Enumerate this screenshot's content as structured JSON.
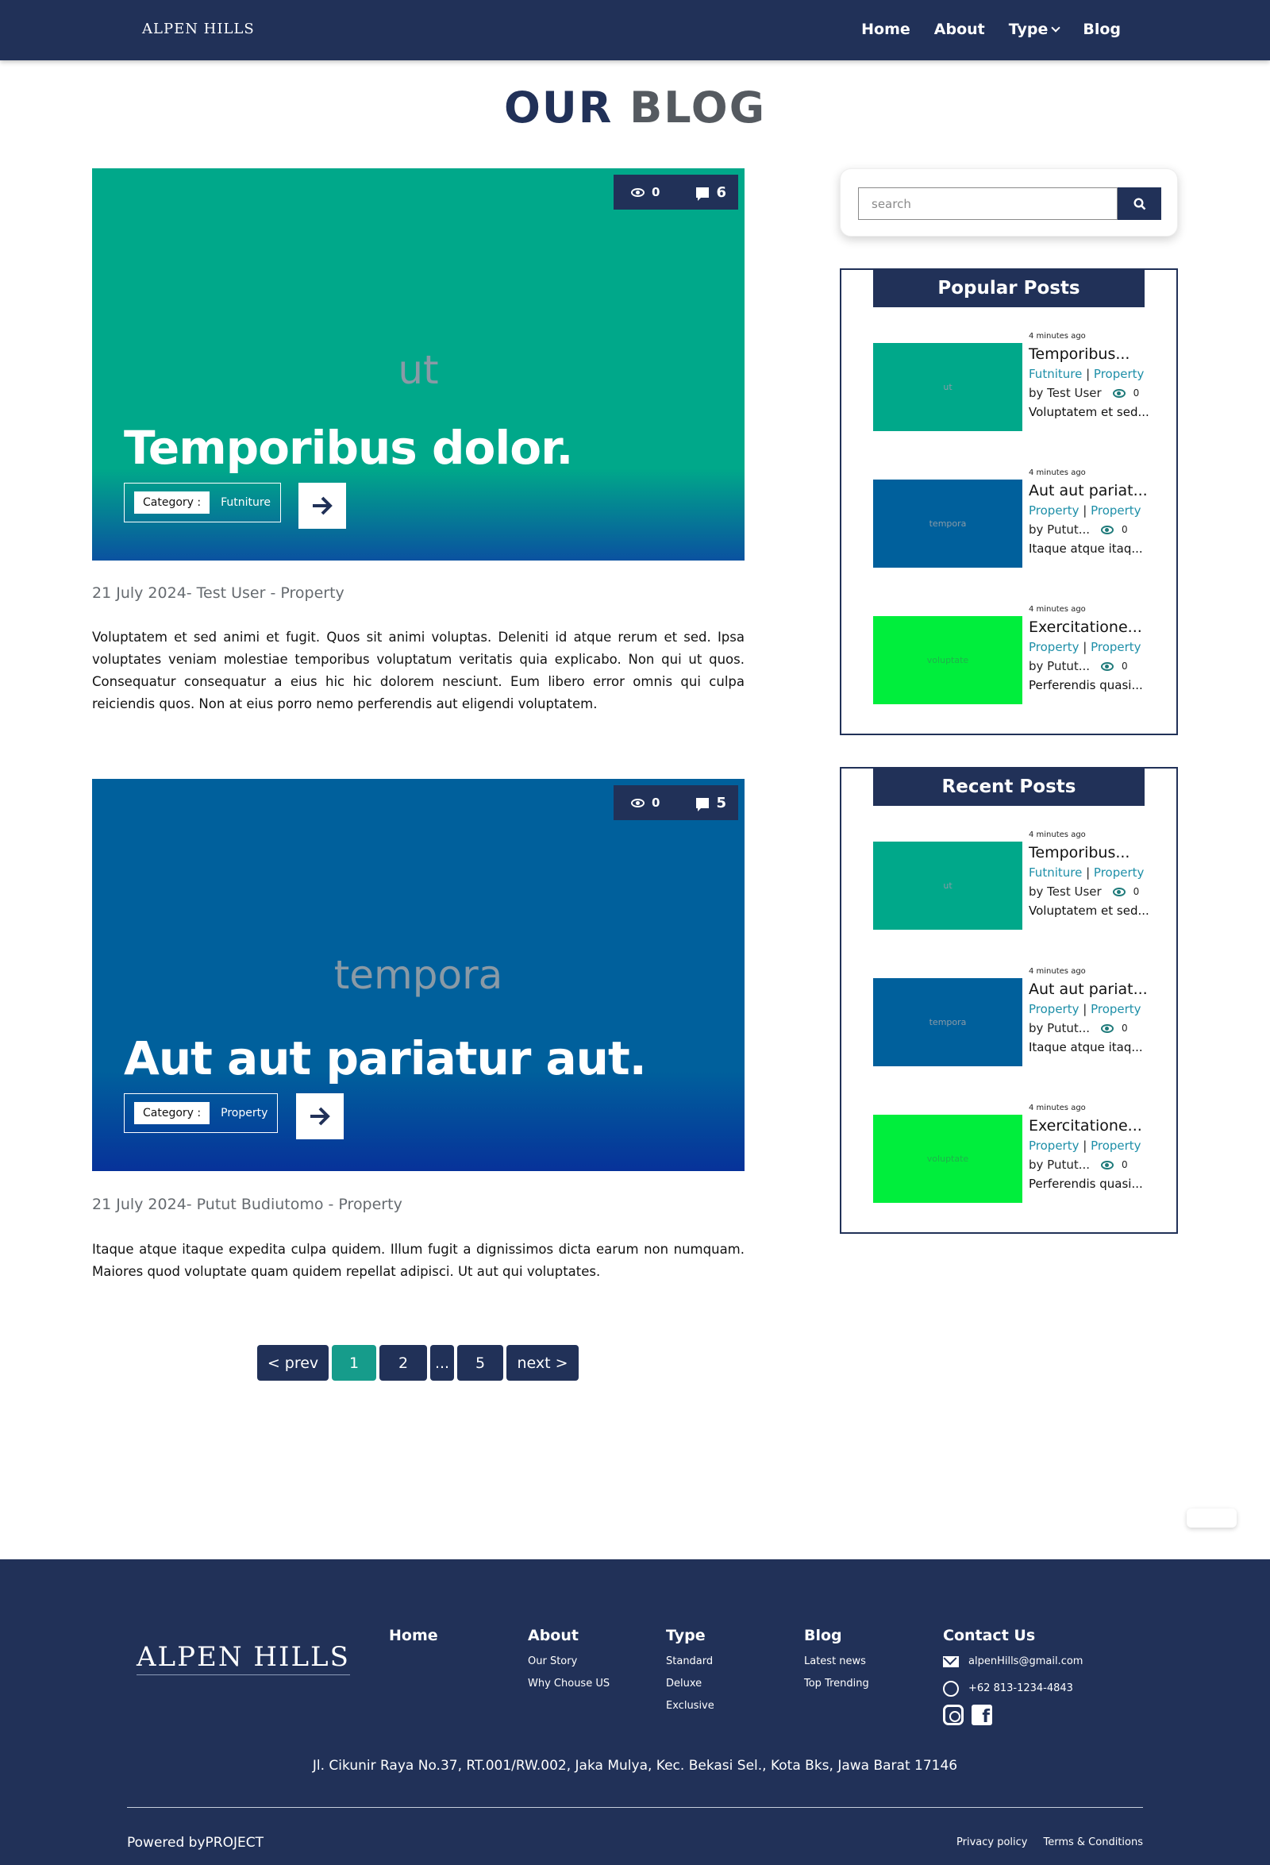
{
  "nav": {
    "brand": "ALPEN HILLS",
    "links": [
      "Home",
      "About",
      "Type",
      "Blog"
    ]
  },
  "title": {
    "part1": "OUR",
    "part2": "BLOG"
  },
  "posts": [
    {
      "image_word": "ut",
      "views": "0",
      "comments": "6",
      "title": "Temporibus dolor.",
      "category_label": "Category :",
      "category": "Futniture",
      "meta": "21 July 2024- Test User - Property",
      "excerpt": "Voluptatem et sed animi et fugit. Quos sit animi voluptas. Deleniti id atque rerum et sed. Ipsa voluptates veniam molestiae temporibus voluptatum veritatis quia explicabo. Non qui ut quos. Consequatur consequatur a eius hic hic dolorem nesciunt. Eum libero error omnis qui culpa reiciendis quos. Non at eius porro nemo perferendis aut eligendi voluptatem.",
      "color": "#00a88a"
    },
    {
      "image_word": "tempora",
      "views": "0",
      "comments": "5",
      "title": "Aut aut pariatur aut.",
      "category_label": "Category :",
      "category": "Property",
      "meta": "21 July 2024- Putut Budiutomo - Property",
      "excerpt": "Itaque atque itaque expedita culpa quidem. Illum fugit a dignissimos dicta earum non numquam. Maiores quod voluptate quam quidem repellat adipisci. Ut aut qui voluptates.",
      "color": "#00609c"
    }
  ],
  "pagination": {
    "prev": "< prev",
    "pages": [
      "1",
      "2",
      "...",
      "5"
    ],
    "next": "next >",
    "active": "1"
  },
  "search": {
    "placeholder": "search"
  },
  "popular": {
    "heading": "Popular Posts",
    "items": [
      {
        "thumb": "ut",
        "color": "#00a88a",
        "ago": "4 minutes ago",
        "title": "Temporibus...",
        "cat1": "Futniture",
        "cat2": "Property",
        "by": "by Test User",
        "views": "0",
        "excerpt": "Voluptatem et sed..."
      },
      {
        "thumb": "tempora",
        "color": "#00609c",
        "ago": "4 minutes ago",
        "title": "Aut aut pariat...",
        "cat1": "Property",
        "cat2": "Property",
        "by": "by Putut...",
        "views": "0",
        "excerpt": "Itaque atque itaq..."
      },
      {
        "thumb": "voluptate",
        "color": "#00ee3c",
        "ago": "4 minutes ago",
        "title": "Exercitatione...",
        "cat1": "Property",
        "cat2": "Property",
        "by": "by Putut...",
        "views": "0",
        "excerpt": "Perferendis quasi..."
      }
    ]
  },
  "recent": {
    "heading": "Recent Posts",
    "items": [
      {
        "thumb": "ut",
        "color": "#00a88a",
        "ago": "4 minutes ago",
        "title": "Temporibus...",
        "cat1": "Futniture",
        "cat2": "Property",
        "by": "by Test User",
        "views": "0",
        "excerpt": "Voluptatem et sed..."
      },
      {
        "thumb": "tempora",
        "color": "#00609c",
        "ago": "4 minutes ago",
        "title": "Aut aut pariat...",
        "cat1": "Property",
        "cat2": "Property",
        "by": "by Putut...",
        "views": "0",
        "excerpt": "Itaque atque itaq..."
      },
      {
        "thumb": "voluptate",
        "color": "#00ee3c",
        "ago": "4 minutes ago",
        "title": "Exercitatione...",
        "cat1": "Property",
        "cat2": "Property",
        "by": "by Putut...",
        "views": "0",
        "excerpt": "Perferendis quasi..."
      }
    ]
  },
  "footer": {
    "brand": "ALPEN HILLS",
    "home": "Home",
    "about": {
      "heading": "About",
      "links": [
        "Our Story",
        "Why Chouse US"
      ]
    },
    "type": {
      "heading": "Type",
      "links": [
        "Standard",
        "Deluxe",
        "Exclusive"
      ]
    },
    "blog": {
      "heading": "Blog",
      "links": [
        "Latest news",
        "Top Trending"
      ]
    },
    "contact": {
      "heading": "Contact Us",
      "email": "alpenHills@gmail.com",
      "phone": "+62 813-1234-4843"
    },
    "address": "Jl. Cikunir Raya No.37, RT.001/RW.002, Jaka Mulya, Kec. Bekasi Sel., Kota Bks, Jawa Barat 17146",
    "powered": "Powered byPROJECT",
    "privacy": "Privacy policy",
    "terms": "Terms & Conditions"
  },
  "colors": {
    "navy": "#213158",
    "teal": "#00a88a",
    "blue": "#00609c",
    "green": "#00ee3c",
    "accent": "#169c8b"
  }
}
